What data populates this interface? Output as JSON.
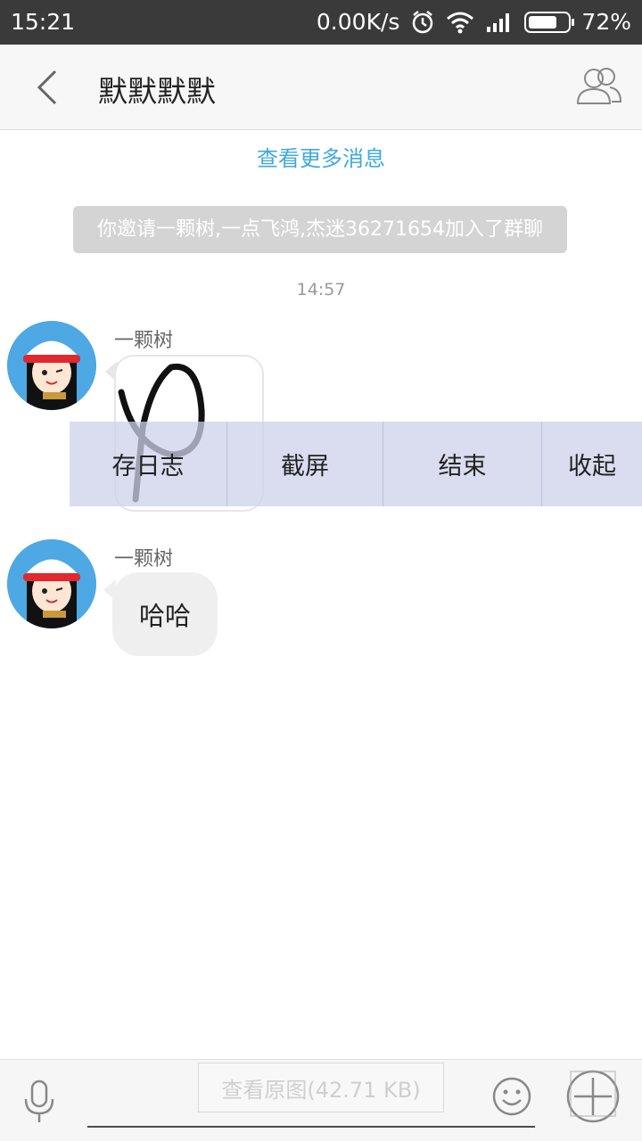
{
  "status_bar": {
    "time": "15:21",
    "speed": "0.00K/s",
    "battery": "72%",
    "battery_fraction": 0.72
  },
  "header": {
    "title": "默默默默",
    "back_icon": "chevron-left-icon",
    "members_icon": "group-members-icon"
  },
  "chat": {
    "load_more": "查看更多消息",
    "system_message": "你邀请一颗树,一点飞鸿,杰迷36271654加入了群聊",
    "timestamp": "14:57",
    "messages": [
      {
        "sender": "一颗树",
        "type": "image"
      },
      {
        "sender": "一颗树",
        "type": "text",
        "text": "哈哈"
      }
    ]
  },
  "overlay_menu": {
    "items": [
      "存日志",
      "截屏",
      "结束",
      "收起"
    ]
  },
  "input_bar": {
    "view_original": "查看原图(42.71 KB)",
    "mic_icon": "microphone-icon",
    "emoji_icon": "emoji-icon",
    "plus_icon": "more-grid-icon"
  },
  "colors": {
    "status_bg": "#3a3a3a",
    "link_blue": "#3fa9e0",
    "bubble_gray": "#efefef"
  }
}
